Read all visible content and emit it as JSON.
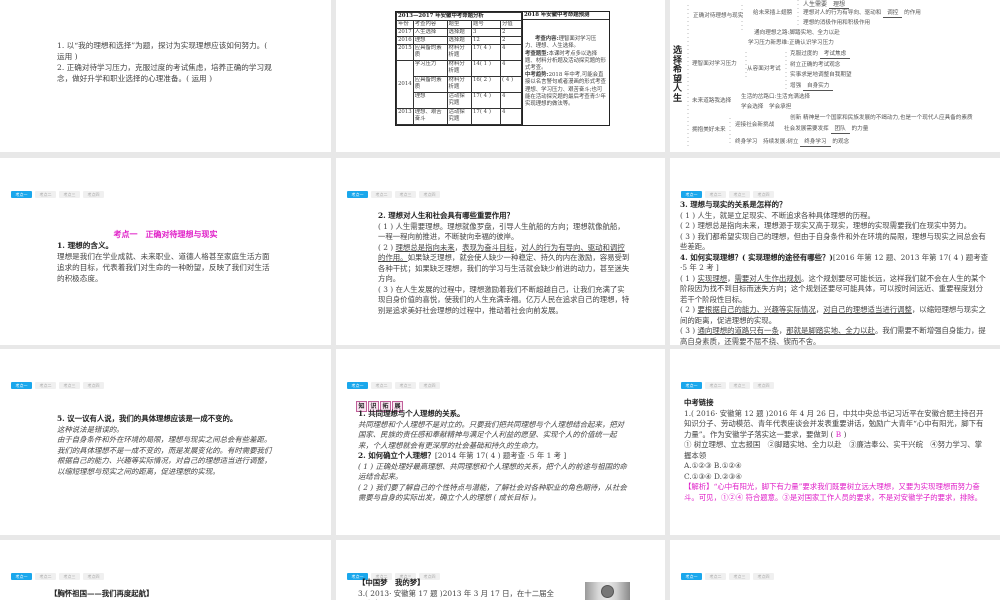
{
  "tabs": [
    "考点一",
    "考点二",
    "考点三",
    "考点四"
  ],
  "colors": {
    "tab_active": "#1aa7ec",
    "magenta": "#e020c8",
    "gap": "#e8e8e8"
  },
  "slides": {
    "r1c1": {
      "paras": [
        [
          "1. 以“我的理想和选择”为题，探讨为实现理想应该如何努力。( 运用 )"
        ],
        [
          "2. 正确对待学习压力，克服过度的考试焦虑，培养正确的学习观念，做好升学和职业选择的心理准备。( 运用 )"
        ]
      ]
    },
    "r1c2": {
      "left_title": "2013—2017 年安徽中考命题分析",
      "right_title": "2018 年安徽中考命题预测",
      "headers": [
        "年份",
        "考查内容",
        "题型",
        "题号",
        "分值"
      ],
      "rows": [
        [
          "2017",
          "人生选择",
          "选择题",
          "3",
          "2"
        ],
        [
          "2016",
          "理想",
          "选择题",
          "12",
          "2"
        ],
        [
          "2015",
          "应具备的素质",
          "材料分析题",
          "17( 4 )",
          "4"
        ],
        [
          "2014",
          "学习压力",
          "材料分析题",
          "14( 1 )",
          "4"
        ],
        [
          "",
          "应具备的素质",
          "材料分析题",
          "16( 2 )",
          "( 4 )"
        ],
        [
          "",
          "理想",
          "活动探究题",
          "17( 4 )",
          "4"
        ],
        [
          "2013",
          "理想、艰苦奋斗",
          "活动探究题",
          "17( 4 )",
          "4"
        ]
      ],
      "prediction": [
        {
          "label": "考查内容:",
          "text": "理智面对学习压力、理想、人生选择。"
        },
        {
          "label": "考查题型:",
          "text": "本课时考点多以选择题、材料分析题及活动探究题的形式考查。"
        },
        {
          "label": "中考趋势:",
          "text": "2018 年中考,可能会直接以名言警句或者漫画的形式考查理想、学习压力、艰苦奋斗;也可能在活动探究题的最后考查青少年实现理想的做法等。"
        }
      ]
    },
    "r1c3": {
      "title": "选择希望人生",
      "nodes": {
        "n0a": "人生需要",
        "n0b": "理想",
        "n1": "正确对待理想与现实",
        "n2": "给未来插上翅膀",
        "n3a": "理想对人的行为有导向、驱动和",
        "n3b": "调控",
        "n3c": "的作用",
        "n4": "理想的消极作用和积极作用",
        "n5": "通向理想之路:脚踏实地、全力以赴",
        "n6": "学习压力新思维:正确认识学习压力",
        "n7a": "克服过度的",
        "n7b": "考试焦虑",
        "n8": "理智面对学习压力",
        "n9": "从容面对考试",
        "n10": "树立正确的考试观念",
        "n11": "实事求是地调整自我期望",
        "n12a": "增强",
        "n12b": "自身实力",
        "n13": "生活的岔路口:生活充满选择",
        "n14": "未来道路我选择",
        "n15": "学会选择　学会承担",
        "n16a": "创新",
        "n16b": "精神是一个国家和民族发展的不竭动力,也是一个现代人应具备的素质",
        "n17": "迎接社会新挑战",
        "n18": "拥抱美好未来",
        "n19a": "社会发展需要发挥",
        "n19b": "团队",
        "n19c": "的力量",
        "n20a": "终身学习　持续发展:树立",
        "n20b": "终身学习",
        "n20c": "的观念"
      }
    },
    "r2c1": {
      "title": "考点一　正确对待理想与现实",
      "paras": [
        [
          {
            "t": "1. 理想的含义。",
            "s": "h"
          }
        ],
        [
          "理想是我们在学业成就、未来职业、道德人格甚至家庭生活方面追求的目标，代表着我们对生命的一种盼望，反映了我们对生活的积极态度。"
        ]
      ]
    },
    "r2c2": {
      "paras": [
        [
          {
            "t": "2. 理想对人生和社会具有哪些重要作用？",
            "s": "h"
          }
        ],
        [
          "( 1 ) 人生需要理想。理想就像罗盘，引导人生航船的方向；理想就像航船，一程一程向前推进，不断驶向幸福的彼岸。"
        ],
        [
          "( 2 ) ",
          {
            "t": "理想总是指向未来",
            "s": "u"
          },
          "，",
          {
            "t": "表现为奋斗目标",
            "s": "u"
          },
          "，",
          {
            "t": "对人的行为有导向、驱动和调控的作用。",
            "s": "u"
          },
          "如果缺乏理想，就会使人缺少一种稳定、持久的内在激励，容易受到各种干扰；如果缺乏理想，我们的学习与生活就会缺少前进的动力，甚至迷失方向。"
        ],
        [
          "( 3 ) 在人生发展的过程中，理想激励着我们不断超越自己，让我们充满了实现自身价值的喜悦，使我们的人生充满幸福。亿万人民在追求自己的理想，特别是追求美好社会理想的过程中，推动着社会向前发展。"
        ]
      ]
    },
    "r2c3": {
      "paras": [
        [
          {
            "t": "3. 理想与现实的关系是怎样的？",
            "s": "h"
          }
        ],
        [
          "( 1 ) 人生，就是立足现实、不断追求各种具体理想的历程。"
        ],
        [
          "( 2 ) 理想总是指向未来，理想源于现实又高于现实，理想的实现需要我们在现实中努力。"
        ],
        [
          "( 3 ) 我们都希望实现自己的理想，但由于自身条件和外在环境的局限，理想与现实之间总会有些差距。"
        ],
        [
          {
            "t": "4. 如何实现理想？( 实现理想的途径有哪些？)",
            "s": "h"
          },
          "[2016 年第 12 题、2013 年第 17( 4 ) 题考查 ·5 年 2 考 ]"
        ],
        [
          "( 1 ) ",
          {
            "t": "实现理想",
            "s": "u"
          },
          "，",
          {
            "t": "需要对人生作出规划",
            "s": "u"
          },
          "。这个规划要尽可能长远，这样我们就不会在人生的某个阶段因为找不到目标而迷失方向；这个规划还要尽可能具体，可以按时间远近、重要程度划分若干个阶段性目标。"
        ],
        [
          "( 2 ) ",
          {
            "t": "要根据自己的能力、兴趣等实际情况",
            "s": "u"
          },
          "，",
          {
            "t": "对自己的理想适当进行调整",
            "s": "u"
          },
          "，以缩短理想与现实之间的距离，促进理想的实现。"
        ],
        [
          "( 3 ) ",
          {
            "t": "通向理想的道路只有一条",
            "s": "u"
          },
          "，",
          {
            "t": "那就是脚踏实地、全力以赴",
            "s": "u"
          },
          "。我们需要不断增强自身能力，提高自身素质，还需要不屈不挠、锲而不舍。"
        ]
      ]
    },
    "r3c1": {
      "paras": [
        [
          {
            "t": "5. 议一议有人说，我们的具体理想应该是一成不变的。",
            "s": "h"
          }
        ],
        [
          {
            "t": "这种说法是错误的。",
            "s": "k"
          }
        ],
        [
          {
            "t": "由于自身条件和外在环境的局限，理想与现实之间总会有些差距。我们的具体理想不是一成不变的，而是发展变化的。有时需要我们根据自己的能力、兴趣等实际情况，对自己的理想适当进行调整，以缩短理想与现实之间的距离，促进理想的实现。",
            "s": "k"
          }
        ]
      ]
    },
    "r3c2": {
      "badge": [
        "知",
        "识",
        "拓",
        "展"
      ],
      "paras": [
        [
          {
            "t": "1. 共同理想与个人理想的关系。",
            "s": "h"
          }
        ],
        [
          {
            "t": "共同理想和个人理想不是对立的。只要我们把共同理想与个人理想结合起来，把对国家、民族的责任感和奉献精神与满足个人利益的愿望、实现个人的价值统一起来，个人理想就会有更深厚的社会基础和持久的生命力。",
            "s": "k"
          }
        ],
        [
          {
            "t": "2. 如何确立个人理想？",
            "s": "h"
          },
          "[2014 年第 17( 4 ) 题考查 ·5 年 1 考 ]"
        ],
        [
          {
            "t": "( 1 ) 正确处理好最高理想、共同理想和个人理想的关系，把个人的前途与祖国的命运结合起来。",
            "s": "k"
          }
        ],
        [
          {
            "t": "( 2 ) 我们要了解自己的个性特点与潜能，了解社会对各种职业的角色期待，从社会需要与自身的实际出发，确立个人的理想 ( 成长目标 )。",
            "s": "k"
          }
        ]
      ]
    },
    "r3c3": {
      "paras": [
        [
          {
            "t": "中考链接",
            "s": "h"
          }
        ],
        [
          "1.( 2016· 安徽第 12 题 )2016 年 4 月 26 日，中共中央总书记习近平在安徽合肥主持召开知识分子、劳动模范、青年代表座谈会并发表重要讲话，勉励广大青年“心中有阳光，脚下有力量”。作为安徽学子落实这一要求，要做到 ( ",
          {
            "t": "B",
            "s": "m"
          },
          " )"
        ],
        [
          "① 树立理想、立志报国　②脚踏实地、全力以赴　③廉洁奉公、实干兴皖　④努力学习、掌握本领"
        ],
        [
          "A.①②③ B.①②④"
        ],
        [
          "C.①③④ D.②③④"
        ],
        [
          {
            "t": "【解析】“心中有阳光，脚下有力量”要求我们既要树立远大理想，又要为实现理想而努力奋斗。可见，①②④ 符合题意。③是对国家工作人员的要求，不是对安徽学子的要求，排除。",
            "s": "m"
          }
        ]
      ]
    },
    "r4c1": {
      "paras": [
        [
          "【胸怀祖国——我们再度起航】"
        ]
      ]
    },
    "r4c2": {
      "paras": [
        [
          {
            "t": "【中国梦　我的梦】",
            "s": "h"
          }
        ],
        [
          "3.( 2013· 安徽第 17 题 )2013 年 3 月 17 日，在十二届全国人大"
        ]
      ]
    },
    "r4c3": {
      "paras": []
    }
  }
}
